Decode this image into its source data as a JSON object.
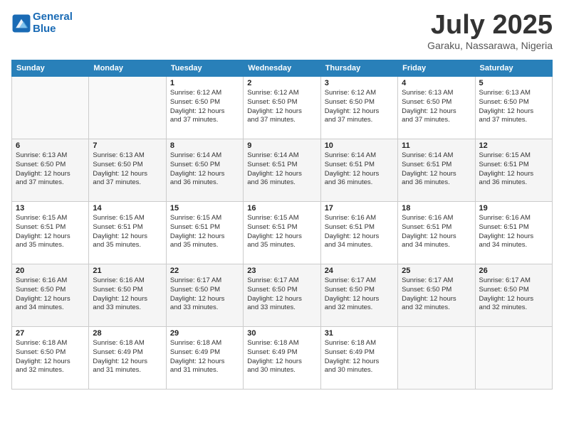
{
  "header": {
    "logo_line1": "General",
    "logo_line2": "Blue",
    "month_title": "July 2025",
    "subtitle": "Garaku, Nassarawa, Nigeria"
  },
  "days_of_week": [
    "Sunday",
    "Monday",
    "Tuesday",
    "Wednesday",
    "Thursday",
    "Friday",
    "Saturday"
  ],
  "weeks": [
    [
      {
        "day": "",
        "info": ""
      },
      {
        "day": "",
        "info": ""
      },
      {
        "day": "1",
        "sunrise": "6:12 AM",
        "sunset": "6:50 PM",
        "daylight": "12 hours and 37 minutes."
      },
      {
        "day": "2",
        "sunrise": "6:12 AM",
        "sunset": "6:50 PM",
        "daylight": "12 hours and 37 minutes."
      },
      {
        "day": "3",
        "sunrise": "6:12 AM",
        "sunset": "6:50 PM",
        "daylight": "12 hours and 37 minutes."
      },
      {
        "day": "4",
        "sunrise": "6:13 AM",
        "sunset": "6:50 PM",
        "daylight": "12 hours and 37 minutes."
      },
      {
        "day": "5",
        "sunrise": "6:13 AM",
        "sunset": "6:50 PM",
        "daylight": "12 hours and 37 minutes."
      }
    ],
    [
      {
        "day": "6",
        "sunrise": "6:13 AM",
        "sunset": "6:50 PM",
        "daylight": "12 hours and 37 minutes."
      },
      {
        "day": "7",
        "sunrise": "6:13 AM",
        "sunset": "6:50 PM",
        "daylight": "12 hours and 37 minutes."
      },
      {
        "day": "8",
        "sunrise": "6:14 AM",
        "sunset": "6:50 PM",
        "daylight": "12 hours and 36 minutes."
      },
      {
        "day": "9",
        "sunrise": "6:14 AM",
        "sunset": "6:51 PM",
        "daylight": "12 hours and 36 minutes."
      },
      {
        "day": "10",
        "sunrise": "6:14 AM",
        "sunset": "6:51 PM",
        "daylight": "12 hours and 36 minutes."
      },
      {
        "day": "11",
        "sunrise": "6:14 AM",
        "sunset": "6:51 PM",
        "daylight": "12 hours and 36 minutes."
      },
      {
        "day": "12",
        "sunrise": "6:15 AM",
        "sunset": "6:51 PM",
        "daylight": "12 hours and 36 minutes."
      }
    ],
    [
      {
        "day": "13",
        "sunrise": "6:15 AM",
        "sunset": "6:51 PM",
        "daylight": "12 hours and 35 minutes."
      },
      {
        "day": "14",
        "sunrise": "6:15 AM",
        "sunset": "6:51 PM",
        "daylight": "12 hours and 35 minutes."
      },
      {
        "day": "15",
        "sunrise": "6:15 AM",
        "sunset": "6:51 PM",
        "daylight": "12 hours and 35 minutes."
      },
      {
        "day": "16",
        "sunrise": "6:15 AM",
        "sunset": "6:51 PM",
        "daylight": "12 hours and 35 minutes."
      },
      {
        "day": "17",
        "sunrise": "6:16 AM",
        "sunset": "6:51 PM",
        "daylight": "12 hours and 34 minutes."
      },
      {
        "day": "18",
        "sunrise": "6:16 AM",
        "sunset": "6:51 PM",
        "daylight": "12 hours and 34 minutes."
      },
      {
        "day": "19",
        "sunrise": "6:16 AM",
        "sunset": "6:51 PM",
        "daylight": "12 hours and 34 minutes."
      }
    ],
    [
      {
        "day": "20",
        "sunrise": "6:16 AM",
        "sunset": "6:50 PM",
        "daylight": "12 hours and 34 minutes."
      },
      {
        "day": "21",
        "sunrise": "6:16 AM",
        "sunset": "6:50 PM",
        "daylight": "12 hours and 33 minutes."
      },
      {
        "day": "22",
        "sunrise": "6:17 AM",
        "sunset": "6:50 PM",
        "daylight": "12 hours and 33 minutes."
      },
      {
        "day": "23",
        "sunrise": "6:17 AM",
        "sunset": "6:50 PM",
        "daylight": "12 hours and 33 minutes."
      },
      {
        "day": "24",
        "sunrise": "6:17 AM",
        "sunset": "6:50 PM",
        "daylight": "12 hours and 32 minutes."
      },
      {
        "day": "25",
        "sunrise": "6:17 AM",
        "sunset": "6:50 PM",
        "daylight": "12 hours and 32 minutes."
      },
      {
        "day": "26",
        "sunrise": "6:17 AM",
        "sunset": "6:50 PM",
        "daylight": "12 hours and 32 minutes."
      }
    ],
    [
      {
        "day": "27",
        "sunrise": "6:18 AM",
        "sunset": "6:50 PM",
        "daylight": "12 hours and 32 minutes."
      },
      {
        "day": "28",
        "sunrise": "6:18 AM",
        "sunset": "6:49 PM",
        "daylight": "12 hours and 31 minutes."
      },
      {
        "day": "29",
        "sunrise": "6:18 AM",
        "sunset": "6:49 PM",
        "daylight": "12 hours and 31 minutes."
      },
      {
        "day": "30",
        "sunrise": "6:18 AM",
        "sunset": "6:49 PM",
        "daylight": "12 hours and 30 minutes."
      },
      {
        "day": "31",
        "sunrise": "6:18 AM",
        "sunset": "6:49 PM",
        "daylight": "12 hours and 30 minutes."
      },
      {
        "day": "",
        "info": ""
      },
      {
        "day": "",
        "info": ""
      }
    ]
  ]
}
